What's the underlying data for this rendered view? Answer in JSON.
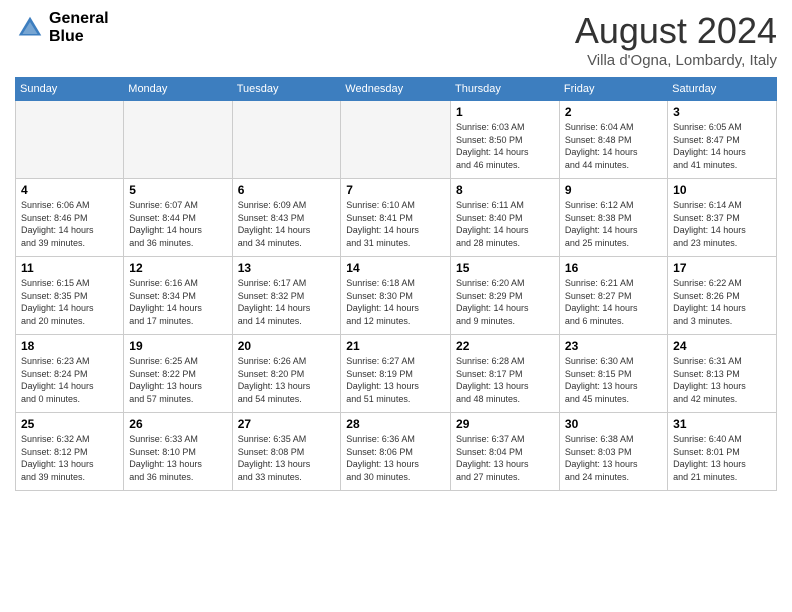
{
  "header": {
    "logo_line1": "General",
    "logo_line2": "Blue",
    "month": "August 2024",
    "location": "Villa d'Ogna, Lombardy, Italy"
  },
  "weekdays": [
    "Sunday",
    "Monday",
    "Tuesday",
    "Wednesday",
    "Thursday",
    "Friday",
    "Saturday"
  ],
  "weeks": [
    [
      {
        "day": "",
        "info": ""
      },
      {
        "day": "",
        "info": ""
      },
      {
        "day": "",
        "info": ""
      },
      {
        "day": "",
        "info": ""
      },
      {
        "day": "1",
        "info": "Sunrise: 6:03 AM\nSunset: 8:50 PM\nDaylight: 14 hours\nand 46 minutes."
      },
      {
        "day": "2",
        "info": "Sunrise: 6:04 AM\nSunset: 8:48 PM\nDaylight: 14 hours\nand 44 minutes."
      },
      {
        "day": "3",
        "info": "Sunrise: 6:05 AM\nSunset: 8:47 PM\nDaylight: 14 hours\nand 41 minutes."
      }
    ],
    [
      {
        "day": "4",
        "info": "Sunrise: 6:06 AM\nSunset: 8:46 PM\nDaylight: 14 hours\nand 39 minutes."
      },
      {
        "day": "5",
        "info": "Sunrise: 6:07 AM\nSunset: 8:44 PM\nDaylight: 14 hours\nand 36 minutes."
      },
      {
        "day": "6",
        "info": "Sunrise: 6:09 AM\nSunset: 8:43 PM\nDaylight: 14 hours\nand 34 minutes."
      },
      {
        "day": "7",
        "info": "Sunrise: 6:10 AM\nSunset: 8:41 PM\nDaylight: 14 hours\nand 31 minutes."
      },
      {
        "day": "8",
        "info": "Sunrise: 6:11 AM\nSunset: 8:40 PM\nDaylight: 14 hours\nand 28 minutes."
      },
      {
        "day": "9",
        "info": "Sunrise: 6:12 AM\nSunset: 8:38 PM\nDaylight: 14 hours\nand 25 minutes."
      },
      {
        "day": "10",
        "info": "Sunrise: 6:14 AM\nSunset: 8:37 PM\nDaylight: 14 hours\nand 23 minutes."
      }
    ],
    [
      {
        "day": "11",
        "info": "Sunrise: 6:15 AM\nSunset: 8:35 PM\nDaylight: 14 hours\nand 20 minutes."
      },
      {
        "day": "12",
        "info": "Sunrise: 6:16 AM\nSunset: 8:34 PM\nDaylight: 14 hours\nand 17 minutes."
      },
      {
        "day": "13",
        "info": "Sunrise: 6:17 AM\nSunset: 8:32 PM\nDaylight: 14 hours\nand 14 minutes."
      },
      {
        "day": "14",
        "info": "Sunrise: 6:18 AM\nSunset: 8:30 PM\nDaylight: 14 hours\nand 12 minutes."
      },
      {
        "day": "15",
        "info": "Sunrise: 6:20 AM\nSunset: 8:29 PM\nDaylight: 14 hours\nand 9 minutes."
      },
      {
        "day": "16",
        "info": "Sunrise: 6:21 AM\nSunset: 8:27 PM\nDaylight: 14 hours\nand 6 minutes."
      },
      {
        "day": "17",
        "info": "Sunrise: 6:22 AM\nSunset: 8:26 PM\nDaylight: 14 hours\nand 3 minutes."
      }
    ],
    [
      {
        "day": "18",
        "info": "Sunrise: 6:23 AM\nSunset: 8:24 PM\nDaylight: 14 hours\nand 0 minutes."
      },
      {
        "day": "19",
        "info": "Sunrise: 6:25 AM\nSunset: 8:22 PM\nDaylight: 13 hours\nand 57 minutes."
      },
      {
        "day": "20",
        "info": "Sunrise: 6:26 AM\nSunset: 8:20 PM\nDaylight: 13 hours\nand 54 minutes."
      },
      {
        "day": "21",
        "info": "Sunrise: 6:27 AM\nSunset: 8:19 PM\nDaylight: 13 hours\nand 51 minutes."
      },
      {
        "day": "22",
        "info": "Sunrise: 6:28 AM\nSunset: 8:17 PM\nDaylight: 13 hours\nand 48 minutes."
      },
      {
        "day": "23",
        "info": "Sunrise: 6:30 AM\nSunset: 8:15 PM\nDaylight: 13 hours\nand 45 minutes."
      },
      {
        "day": "24",
        "info": "Sunrise: 6:31 AM\nSunset: 8:13 PM\nDaylight: 13 hours\nand 42 minutes."
      }
    ],
    [
      {
        "day": "25",
        "info": "Sunrise: 6:32 AM\nSunset: 8:12 PM\nDaylight: 13 hours\nand 39 minutes."
      },
      {
        "day": "26",
        "info": "Sunrise: 6:33 AM\nSunset: 8:10 PM\nDaylight: 13 hours\nand 36 minutes."
      },
      {
        "day": "27",
        "info": "Sunrise: 6:35 AM\nSunset: 8:08 PM\nDaylight: 13 hours\nand 33 minutes."
      },
      {
        "day": "28",
        "info": "Sunrise: 6:36 AM\nSunset: 8:06 PM\nDaylight: 13 hours\nand 30 minutes."
      },
      {
        "day": "29",
        "info": "Sunrise: 6:37 AM\nSunset: 8:04 PM\nDaylight: 13 hours\nand 27 minutes."
      },
      {
        "day": "30",
        "info": "Sunrise: 6:38 AM\nSunset: 8:03 PM\nDaylight: 13 hours\nand 24 minutes."
      },
      {
        "day": "31",
        "info": "Sunrise: 6:40 AM\nSunset: 8:01 PM\nDaylight: 13 hours\nand 21 minutes."
      }
    ]
  ]
}
